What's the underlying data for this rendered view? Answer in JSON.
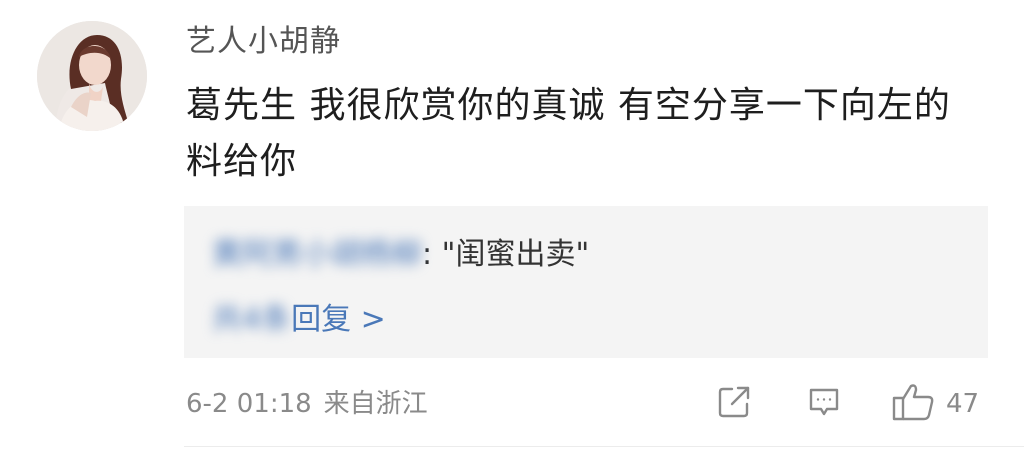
{
  "comment": {
    "username": "艺人小胡静",
    "text": "葛先生 我很欣赏你的真诚 有空分享一下向左的料给你",
    "reply_preview": {
      "author": "黄阿男小胡杨柳",
      "separator": ": ",
      "text": "\"闺蜜出卖\"",
      "more_prefix": "共4条",
      "more_label": "回复 >"
    },
    "date": "6-2 01:18",
    "location": "来自浙江",
    "like_count": "47"
  },
  "icons": {
    "share": "share-icon",
    "reply": "comment-icon",
    "like": "thumbs-up-icon"
  },
  "colors": {
    "link": "#4a78b8",
    "meta": "#8a8a8a",
    "reply_bg": "#f4f4f4"
  }
}
